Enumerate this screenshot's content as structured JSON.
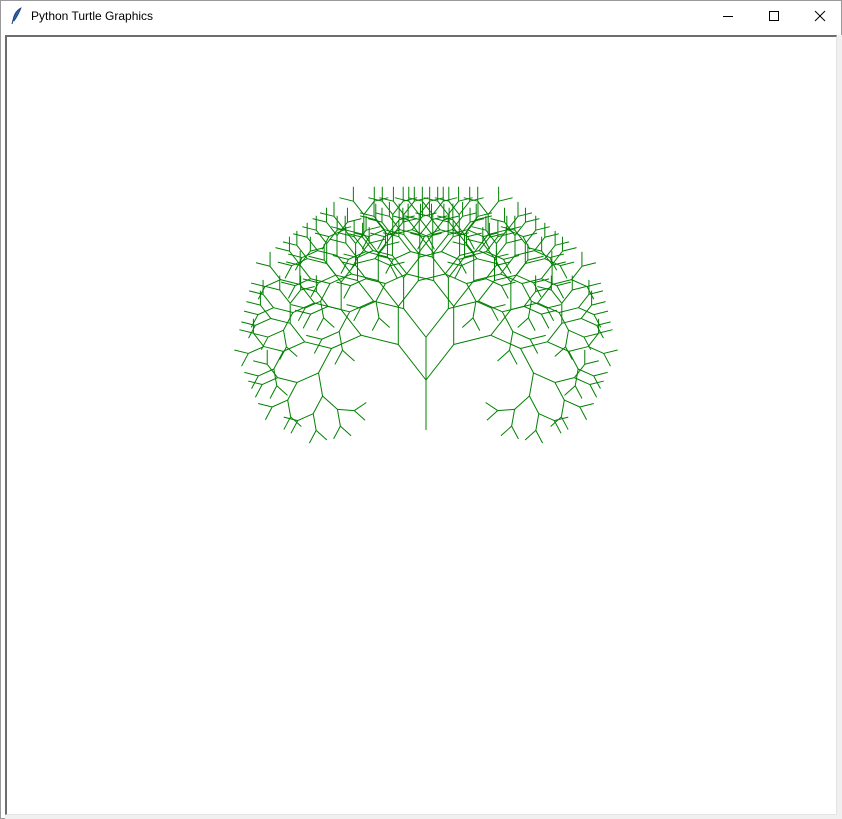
{
  "window": {
    "title": "Python Turtle Graphics",
    "controls": {
      "minimize": "minimize-icon",
      "maximize": "maximize-icon",
      "close": "close-icon"
    }
  },
  "canvas": {
    "background": "#ffffff",
    "pen_color": "#008000",
    "drawing": "fractal-tree",
    "tree": {
      "trunk_length": 50,
      "branch_length": 45,
      "scale": 0.85,
      "spread_degrees": 38,
      "depth": 8
    }
  }
}
